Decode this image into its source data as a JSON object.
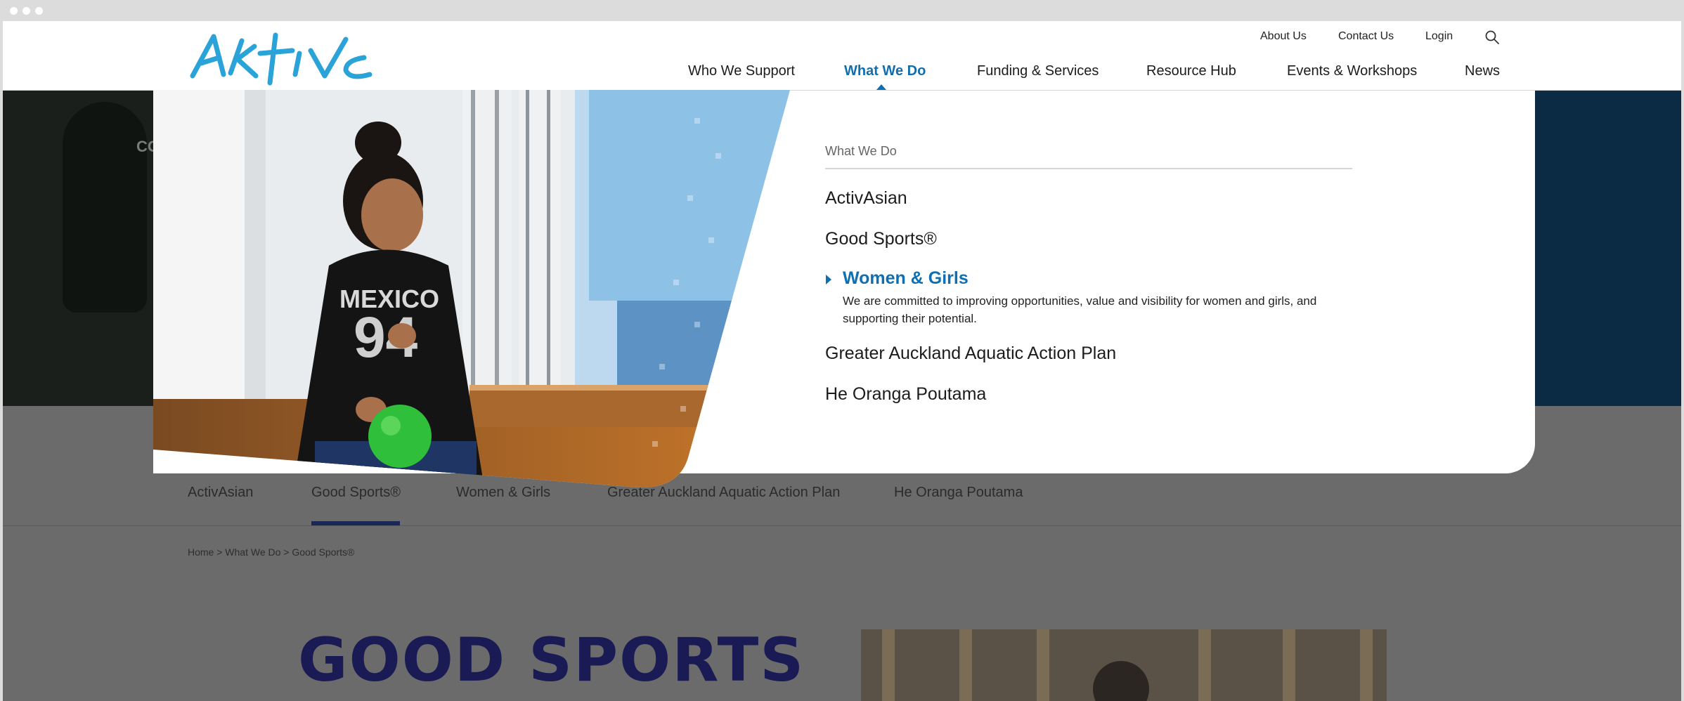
{
  "header": {
    "utility": [
      "About Us",
      "Contact Us",
      "Login"
    ],
    "nav": [
      "Who We Support",
      "What We Do",
      "Funding & Services",
      "Resource Hub",
      "Events & Workshops",
      "News"
    ],
    "active_nav": "What We Do",
    "brand_color": "#0e6fb3",
    "logo_color": "#2aa3d9"
  },
  "hero": {
    "partial_text": "CO"
  },
  "mega_menu": {
    "heading": "What We Do",
    "items": [
      {
        "label": "ActivAsian"
      },
      {
        "label": "Good Sports®"
      },
      {
        "label": "Women & Girls",
        "description": "We are committed to improving opportunities, value and visibility for women and girls, and supporting their potential."
      },
      {
        "label": "Greater Auckland Aquatic Action Plan"
      },
      {
        "label": "He Oranga Poutama"
      }
    ],
    "active_index": 2
  },
  "subnav": {
    "items": [
      "ActivAsian",
      "Good Sports®",
      "Women & Girls",
      "Greater Auckland Aquatic Action Plan",
      "He Oranga Poutama"
    ],
    "active_index": 1
  },
  "breadcrumb": "Home > What We Do > Good Sports®",
  "content": {
    "logo_text": "GOOD SPORTS"
  }
}
